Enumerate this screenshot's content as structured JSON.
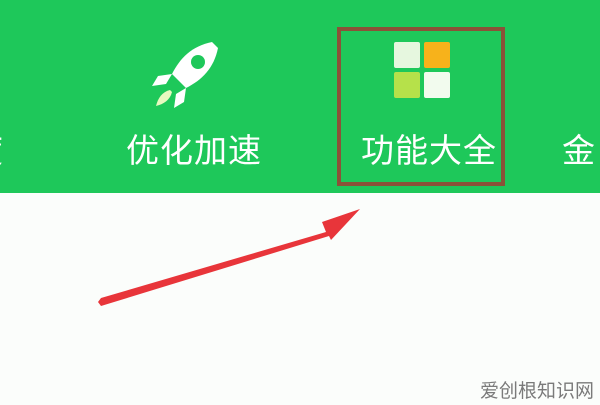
{
  "toolbar": {
    "items": [
      {
        "label": "度",
        "icon": "cut-off-item"
      },
      {
        "label": "优化加速",
        "icon": "rocket-icon"
      },
      {
        "label": "功能大全",
        "icon": "app-grid-icon"
      },
      {
        "label": "金",
        "icon": "cut-off-item"
      }
    ]
  },
  "annotation": {
    "highlight_color": "#8b5238",
    "arrow_color": "#e8353a"
  },
  "watermark": "爱创根知识网",
  "colors": {
    "toolbar_bg": "#1ec85a",
    "label": "#ffffff",
    "content_bg": "#fbfdfb"
  }
}
